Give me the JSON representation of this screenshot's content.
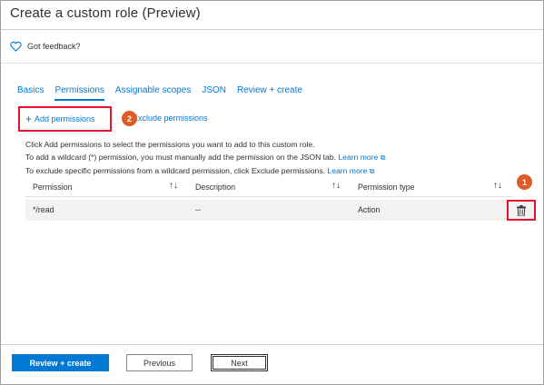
{
  "header": {
    "title": "Create a custom role (Preview)"
  },
  "feedback": {
    "label": "Got feedback?",
    "icon": "heart-icon"
  },
  "tabs": [
    {
      "label": "Basics",
      "active": false
    },
    {
      "label": "Permissions",
      "active": true
    },
    {
      "label": "Assignable scopes",
      "active": false
    },
    {
      "label": "JSON",
      "active": false
    },
    {
      "label": "Review + create",
      "active": false
    }
  ],
  "toolbar": {
    "add_plus": "+",
    "add_label": "Add permissions",
    "exclude_label": "Exclude permissions"
  },
  "callouts": {
    "add_badge": "2",
    "delete_badge": "1",
    "badge_color": "#de5a26",
    "highlight_color": "#e8112d"
  },
  "info": {
    "line1": "Click Add permissions to select the permissions you want to add to this custom role.",
    "line2_text": "To add a wildcard (*) permission, you must manually add the permission on the JSON tab.",
    "line2_link": "Learn more",
    "line3_text": "To exclude specific permissions from a wildcard permission, click Exclude permissions.",
    "line3_link": "Learn more",
    "external_glyph": "⧉"
  },
  "table": {
    "columns": [
      "Permission",
      "Description",
      "Permission type"
    ],
    "sort_glyph": "↑↓",
    "rows": [
      {
        "permission": "*/read",
        "description": "--",
        "type": "Action"
      }
    ]
  },
  "footer": {
    "primary_label": "Review + create",
    "previous_label": "Previous",
    "next_label": "Next"
  },
  "colors": {
    "accent": "#0078d4",
    "text": "#323130"
  }
}
